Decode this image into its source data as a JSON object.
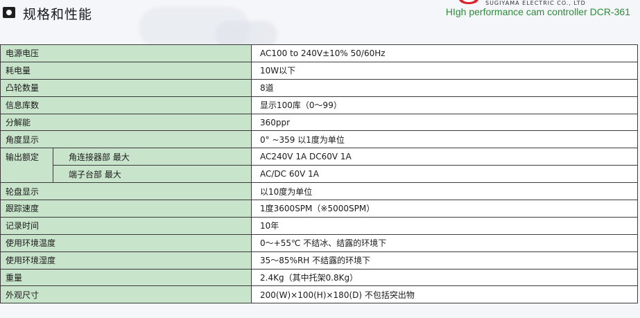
{
  "header": {
    "title": "规格和性能",
    "company": "SUGIYAMA  ELECTRIC  CO.,  LTD",
    "product": "HIgh performance cam controller DCR-361"
  },
  "specs": {
    "output_group_label": "输出额定",
    "rows": [
      {
        "label": "电源电压",
        "value": "AC100 to 240V±10% 50/60Hz"
      },
      {
        "label": "耗电量",
        "value": "10W以下"
      },
      {
        "label": "凸轮数量",
        "value": "8道"
      },
      {
        "label": "信息库数",
        "value": "显示100库（0～99）"
      },
      {
        "label": "分解能",
        "value": "360ppr"
      },
      {
        "label": "角度显示",
        "value": "0° ~359  以1度为单位"
      },
      {
        "label": "角连接器部 最大",
        "value": "AC240V  1A  DC60V  1A"
      },
      {
        "label": "端子台部 最大",
        "value": "AC/DC  60V  1A"
      },
      {
        "label": "轮盘显示",
        "value": "以10度为单位"
      },
      {
        "label": "跟踪速度",
        "value": "1度3600SPM（※5000SPM）"
      },
      {
        "label": "记录时间",
        "value": "10年"
      },
      {
        "label": "使用环境温度",
        "value": "0～+55℃  不结冰、结露的环境下"
      },
      {
        "label": "使用环境湿度",
        "value": "35～85%RH  不结露的环境下"
      },
      {
        "label": "重量",
        "value": "2.4Kg（其中托架0.8Kg）"
      },
      {
        "label": "外观尺寸",
        "value": "200(W)×100(H)×180(D) 不包括突出物"
      }
    ]
  },
  "colors": {
    "label_bg": "#c8e4cb",
    "brand_green": "#2e8b3a",
    "logo_red": "#d8232a"
  }
}
